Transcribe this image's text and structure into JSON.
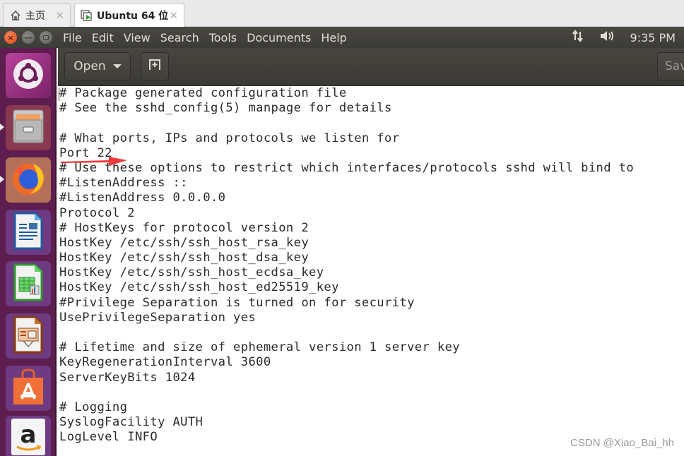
{
  "host_tabs": [
    {
      "label": "主页",
      "icon": "home-icon",
      "active": false
    },
    {
      "label": "Ubuntu 64 位",
      "icon": "vm-icon",
      "active": true
    }
  ],
  "panel": {
    "menu": [
      "File",
      "Edit",
      "View",
      "Search",
      "Tools",
      "Documents",
      "Help"
    ],
    "clock": "9:35 PM",
    "indicators": [
      "network-icon",
      "volume-icon"
    ]
  },
  "launcher": {
    "items": [
      {
        "name": "dash-home",
        "icon": "ubuntu-logo-icon"
      },
      {
        "name": "files",
        "icon": "file-cabinet-icon",
        "running": true
      },
      {
        "name": "firefox",
        "icon": "firefox-icon",
        "running": true
      },
      {
        "name": "libreoffice-writer",
        "icon": "writer-icon"
      },
      {
        "name": "libreoffice-calc",
        "icon": "calc-icon"
      },
      {
        "name": "libreoffice-impress",
        "icon": "impress-icon"
      },
      {
        "name": "ubuntu-software",
        "icon": "software-center-icon"
      },
      {
        "name": "amazon",
        "icon": "amazon-icon"
      }
    ]
  },
  "toolbar": {
    "open_label": "Open",
    "new_tab_icon": "new-document-icon",
    "save_label": "Sav"
  },
  "editor": {
    "lines": [
      "# Package generated configuration file",
      "# See the sshd_config(5) manpage for details",
      "",
      "# What ports, IPs and protocols we listen for",
      "Port 22",
      "# Use these options to restrict which interfaces/protocols sshd will bind to",
      "#ListenAddress ::",
      "#ListenAddress 0.0.0.0",
      "Protocol 2",
      "# HostKeys for protocol version 2",
      "HostKey /etc/ssh/ssh_host_rsa_key",
      "HostKey /etc/ssh/ssh_host_dsa_key",
      "HostKey /etc/ssh/ssh_host_ecdsa_key",
      "HostKey /etc/ssh/ssh_host_ed25519_key",
      "#Privilege Separation is turned on for security",
      "UsePrivilegeSeparation yes",
      "",
      "# Lifetime and size of ephemeral version 1 server key",
      "KeyRegenerationInterval 3600",
      "ServerKeyBits 1024",
      "",
      "# Logging",
      "SyslogFacility AUTH",
      "LogLevel INFO"
    ]
  },
  "annotation": {
    "type": "arrow",
    "color": "#f03a3a",
    "points_to": "Port 22"
  },
  "watermark": "CSDN @Xiao_Bai_hh",
  "colors": {
    "launcher_bg": "#5d1e4f",
    "panel_bg": "#3c3b37",
    "close_button": "#e9541d",
    "text": "#2b2b2b"
  }
}
